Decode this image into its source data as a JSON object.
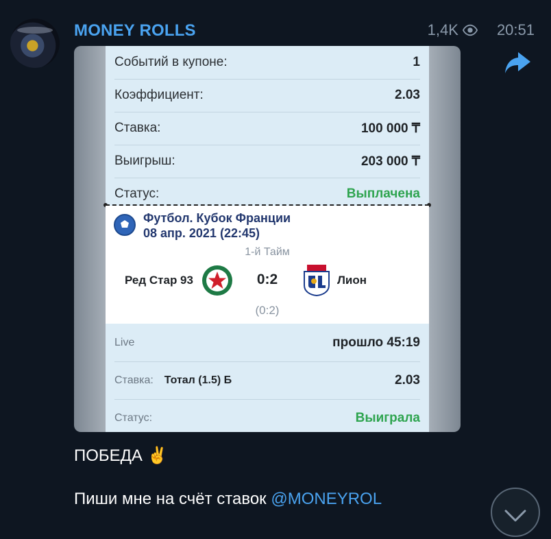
{
  "channel": {
    "name": "MONEY ROLLS",
    "views": "1,4K",
    "time": "20:51"
  },
  "icons": {
    "views": "eye-icon",
    "share": "share-arrow-icon",
    "scroll": "chevron-down-icon"
  },
  "receipt": {
    "rows": [
      {
        "label": "Событий в купоне:",
        "value": "1"
      },
      {
        "label": "Коэффициент:",
        "value": "2.03"
      },
      {
        "label": "Ставка:",
        "value": "100 000 ₸"
      },
      {
        "label": "Выигрыш:",
        "value": "203 000 ₸"
      },
      {
        "label": "Статус:",
        "value": "Выплачена"
      }
    ],
    "match": {
      "league": "Футбол. Кубок Франции",
      "date": "08 апр. 2021 (22:45)",
      "period": "1-й Тайм",
      "team1": "Ред Стар 93",
      "score": "0:2",
      "team2": "Лион",
      "sub_score": "(0:2)"
    },
    "live": {
      "label": "Live",
      "value": "прошло 45:19"
    },
    "bet": {
      "label": "Ставка:",
      "market": "Тотал (1.5) Б",
      "odds": "2.03"
    },
    "status": {
      "label": "Статус:",
      "value": "Выиграла"
    }
  },
  "messages": {
    "line1": "ПОБЕДА ✌️",
    "line2_text": "Пиши мне на счёт ставок ",
    "line2_link": "@MONEYROL"
  },
  "colors": {
    "background": "#0e1621",
    "accent": "#4aa3f0",
    "success": "#2ea44f",
    "receipt_bg": "#dcecf6"
  }
}
